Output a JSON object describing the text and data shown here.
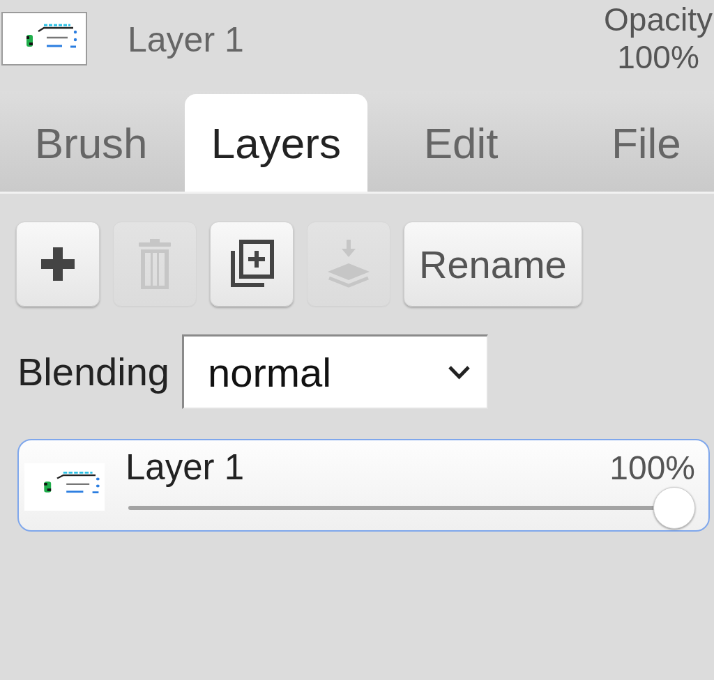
{
  "header": {
    "layer_name": "Layer 1",
    "opacity_label": "Opacity",
    "opacity_value": "100%"
  },
  "tabs": [
    {
      "label": "Brush",
      "selected": false
    },
    {
      "label": "Layers",
      "selected": true
    },
    {
      "label": "Edit",
      "selected": false
    },
    {
      "label": "File",
      "selected": false
    }
  ],
  "toolbar": [
    {
      "kind": "add",
      "disabled": false
    },
    {
      "kind": "delete",
      "disabled": true
    },
    {
      "kind": "duplicate",
      "disabled": false
    },
    {
      "kind": "merge_down",
      "disabled": true
    },
    {
      "kind": "rename",
      "label": "Rename",
      "disabled": false
    }
  ],
  "blending": {
    "label": "Blending",
    "value": "normal"
  },
  "layers": [
    {
      "name": "Layer 1",
      "opacity": "100%",
      "level": 1,
      "selected": true
    }
  ]
}
